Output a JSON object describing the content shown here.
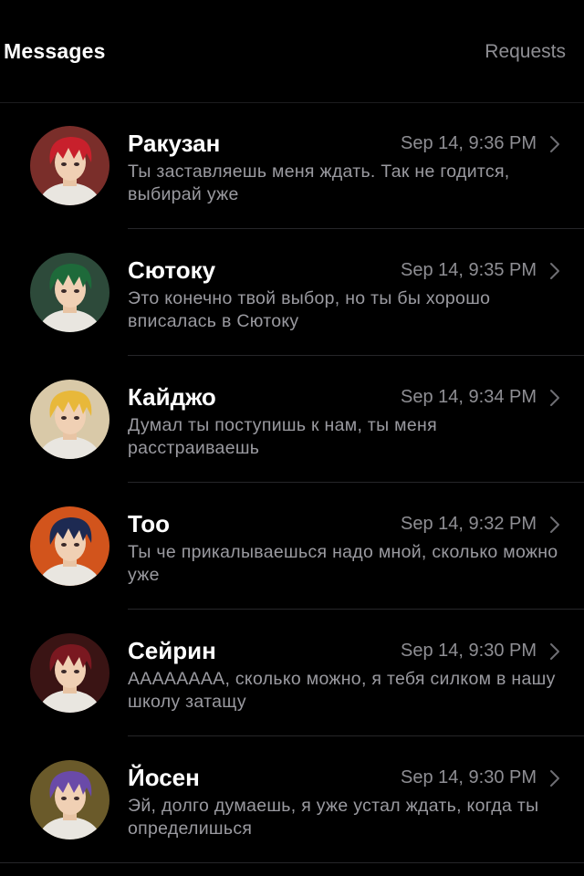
{
  "header": {
    "title": "Messages",
    "requests_label": "Requests"
  },
  "conversations": [
    {
      "name": "Ракузан",
      "time": "Sep 14, 9:36 PM",
      "preview": "Ты заставляешь меня ждать. Так не годится, выбирай уже",
      "avatar_hair": "#c8202c",
      "avatar_bg": "#7a2e2a"
    },
    {
      "name": "Сютоку",
      "time": "Sep 14, 9:35 PM",
      "preview": "Это конечно твой выбор, но ты бы хорошо вписалась в Сютоку",
      "avatar_hair": "#1e6a3a",
      "avatar_bg": "#2d4a3a"
    },
    {
      "name": "Кайджо",
      "time": "Sep 14, 9:34 PM",
      "preview": "Думал ты поступишь к нам, ты меня расстраиваешь",
      "avatar_hair": "#e8b83a",
      "avatar_bg": "#d9c9a8"
    },
    {
      "name": "Тоо",
      "time": "Sep 14, 9:32 PM",
      "preview": "Ты че прикалываешься надо мной, сколько можно уже",
      "avatar_hair": "#1d2a52",
      "avatar_bg": "#d2541c"
    },
    {
      "name": "Сейрин",
      "time": "Sep 14, 9:30 PM",
      "preview": "AAAAAAAA, сколько можно, я тебя силком в нашу школу затащу",
      "avatar_hair": "#7a1820",
      "avatar_bg": "#3a1414"
    },
    {
      "name": "Йосен",
      "time": "Sep 14, 9:30 PM",
      "preview": "Эй, долго думаешь, я уже устал ждать, когда ты определишься",
      "avatar_hair": "#6a4aa8",
      "avatar_bg": "#6a5a2a"
    }
  ]
}
